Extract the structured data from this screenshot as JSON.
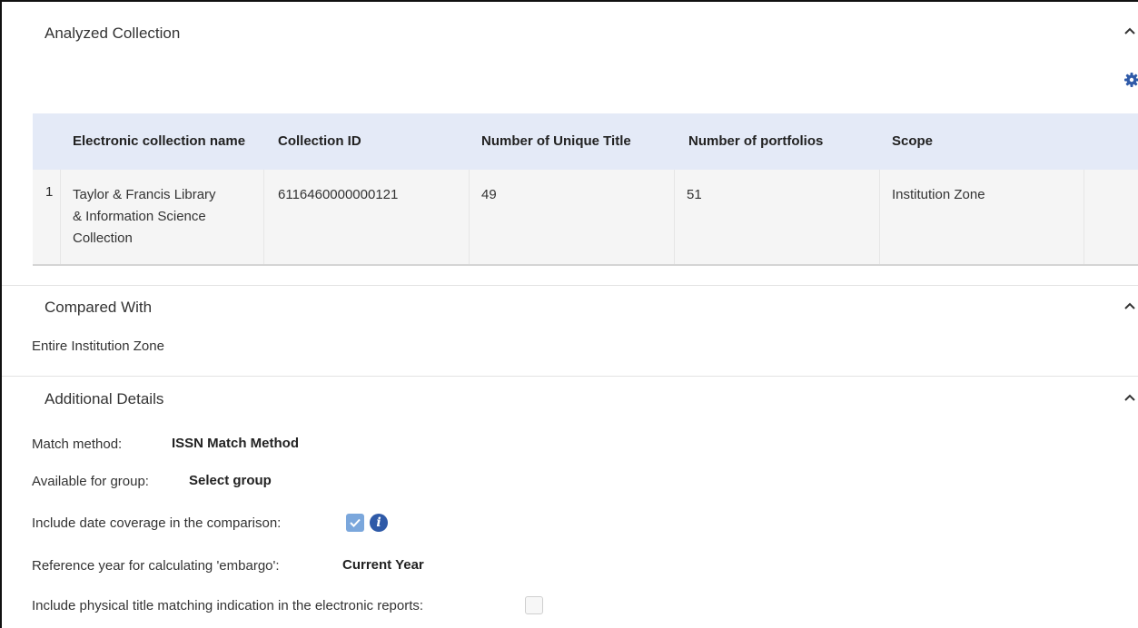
{
  "analyzed": {
    "title": "Analyzed Collection",
    "columns": [
      "Electronic collection name",
      "Collection ID",
      "Number of Unique Title",
      "Number of portfolios",
      "Scope"
    ],
    "rows": [
      {
        "index": "1",
        "name_lines": [
          "Taylor & Francis Library",
          "& Information Science",
          "Collection"
        ],
        "collection_id": "6116460000000121",
        "unique_titles": "49",
        "portfolios": "51",
        "scope": "Institution Zone"
      }
    ]
  },
  "compared": {
    "title": "Compared With",
    "value": "Entire Institution Zone"
  },
  "additional": {
    "title": "Additional Details",
    "match_method_label": "Match method:",
    "match_method_value": "ISSN Match Method",
    "group_label": "Available for group:",
    "group_value": "Select group",
    "date_coverage_label": "Include date coverage in the comparison:",
    "date_coverage_checked": true,
    "embargo_label": "Reference year for calculating 'embargo':",
    "embargo_value": "Current Year",
    "physical_label": "Include physical title matching indication in the electronic reports:",
    "physical_checked": false
  },
  "icons": {
    "collapse": "chevron-up-icon",
    "settings": "gear-icon",
    "info": "info-icon",
    "check": "check-icon"
  },
  "colors": {
    "table_header_bg": "#e4eaf7",
    "checkbox_checked": "#7ba7dc",
    "info_icon": "#2f5aa8",
    "gear_icon": "#2f5aa8"
  }
}
